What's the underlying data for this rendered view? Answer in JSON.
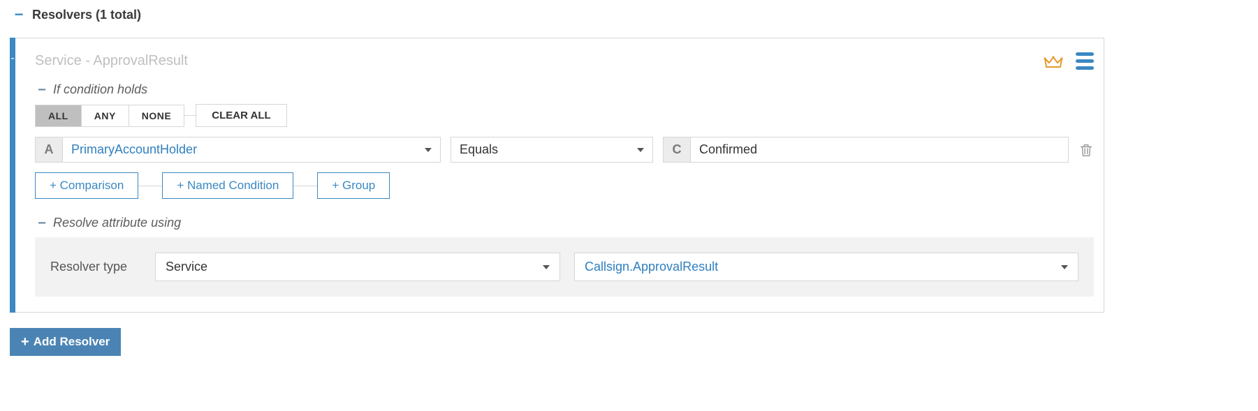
{
  "header": {
    "title": "Resolvers (1 total)"
  },
  "card": {
    "title": "Service - ApprovalResult",
    "condition_header": "If condition holds",
    "resolve_header": "Resolve attribute using"
  },
  "logic": {
    "all": "ALL",
    "any": "ANY",
    "none": "NONE",
    "clear": "CLEAR ALL"
  },
  "condition": {
    "attr_badge": "A",
    "attr_value": "PrimaryAccountHolder",
    "operator": "Equals",
    "val_badge": "C",
    "val_value": "Confirmed"
  },
  "add_buttons": {
    "comparison": "+ Comparison",
    "named": "+ Named Condition",
    "group": "+ Group"
  },
  "resolver": {
    "type_label": "Resolver type",
    "type_value": "Service",
    "target_value": "Callsign.ApprovalResult"
  },
  "footer": {
    "add_resolver": "Add Resolver"
  },
  "colors": {
    "accent": "#3b88c3",
    "link": "#2f7fbf",
    "crown": "#e59a2c"
  }
}
